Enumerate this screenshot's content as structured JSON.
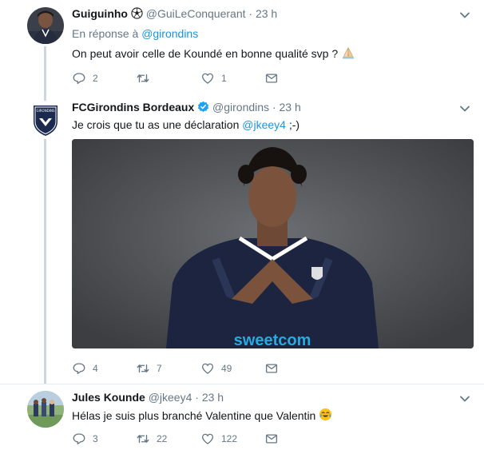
{
  "tweets": [
    {
      "display_name": "Guiguinho",
      "name_emoji": "soccer-ball",
      "handle": "@GuiLeConquerant",
      "separator": "·",
      "time": "23 h",
      "reply_prefix": "En réponse à",
      "reply_mention": "@girondins",
      "text": "On peut avoir celle de Koundé en bonne qualité svp ?",
      "text_emoji": "folded-hands",
      "replies": "2",
      "retweets": "",
      "likes": "1"
    },
    {
      "display_name": "FCGirondins Bordeaux",
      "verified": true,
      "handle": "@girondins",
      "separator": "·",
      "time": "23 h",
      "text": "Je crois que tu as une déclaration",
      "text_mention": "@jkeey4",
      "text_suffix": ";-)",
      "media_sponsor": "sweetcom",
      "replies": "4",
      "retweets": "7",
      "likes": "49"
    },
    {
      "display_name": "Jules Kounde",
      "handle": "@jkeey4",
      "separator": "·",
      "time": "23 h",
      "text": "Hélas je suis plus branché Valentine que Valentin",
      "text_emoji": "face-with-tears-of-joy",
      "replies": "3",
      "retweets": "22",
      "likes": "122"
    }
  ],
  "icons": {
    "reply": "reply-icon",
    "retweet": "retweet-icon",
    "like": "heart-icon",
    "dm": "envelope-icon",
    "caret": "chevron-down-icon"
  },
  "colors": {
    "link": "#1b95e0",
    "secondary": "#657786",
    "verified": "#1da1f2",
    "thread_line": "#ccd6dd",
    "divider": "#e6ecf0"
  }
}
